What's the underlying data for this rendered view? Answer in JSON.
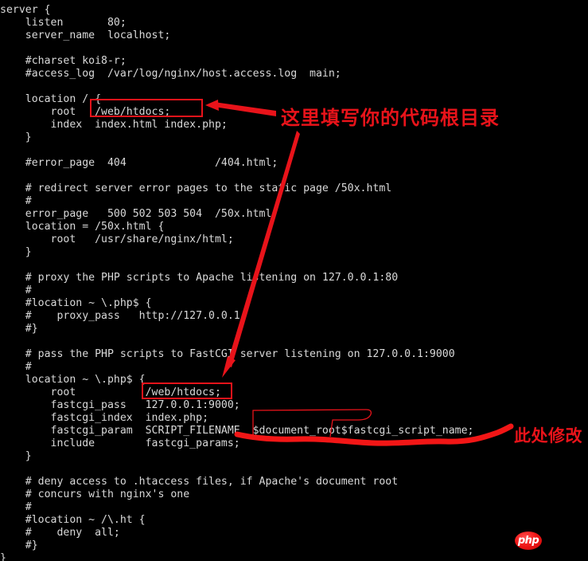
{
  "terminal": {
    "background_color": "#000000",
    "text_color": "#d9d9d9",
    "annotation_color": "#e8131a",
    "code": "server {\n    listen       80;\n    server_name  localhost;\n\n    #charset koi8-r;\n    #access_log  /var/log/nginx/host.access.log  main;\n\n    location / {\n        root   /web/htdocs;\n        index  index.html index.php;\n    }\n\n    #error_page  404              /404.html;\n\n    # redirect server error pages to the static page /50x.html\n    #\n    error_page   500 502 503 504  /50x.html;\n    location = /50x.html {\n        root   /usr/share/nginx/html;\n    }\n\n    # proxy the PHP scripts to Apache listening on 127.0.0.1:80\n    #\n    #location ~ \\.php$ {\n    #    proxy_pass   http://127.0.0.1;\n    #}\n\n    # pass the PHP scripts to FastCGI server listening on 127.0.0.1:9000\n    #\n    location ~ \\.php$ {\n        root           /web/htdocs;\n        fastcgi_pass   127.0.0.1:9000;\n        fastcgi_index  index.php;\n        fastcgi_param  SCRIPT_FILENAME  $document_root$fastcgi_script_name;\n        include        fastcgi_params;\n    }\n\n    # deny access to .htaccess files, if Apache's document root\n    # concurs with nginx's one\n    #\n    #location ~ /\\.ht {\n    #    deny  all;\n    #}\n}"
  },
  "annotations": {
    "root_directory_note": "这里填写你的代码根目录",
    "modify_here_note": "此处修改",
    "highlight_root_1": "/web/htdocs;",
    "highlight_root_2": "/web/htdocs;",
    "underlined_value": "$document_root$fastcgi_script_name;"
  },
  "watermark": {
    "logo_text": "php"
  }
}
